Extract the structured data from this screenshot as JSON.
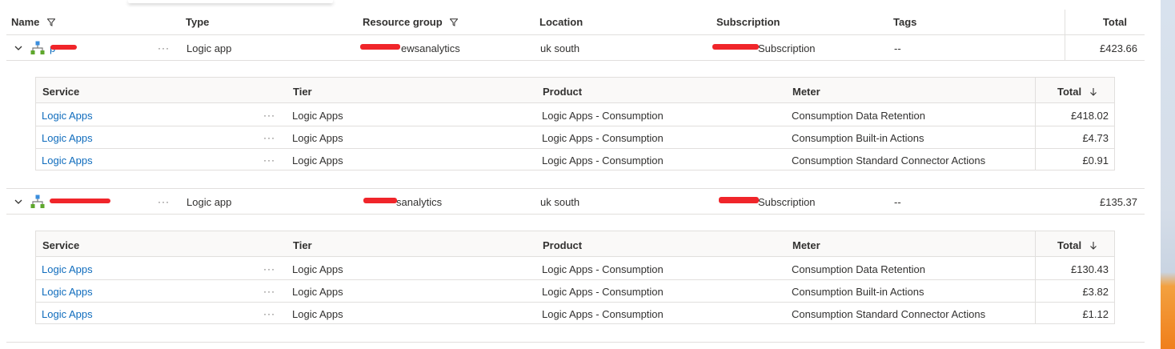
{
  "columns": {
    "name": "Name",
    "type": "Type",
    "resource_group": "Resource group",
    "location": "Location",
    "subscription": "Subscription",
    "tags": "Tags",
    "total": "Total"
  },
  "sub_columns": {
    "service": "Service",
    "tier": "Tier",
    "product": "Product",
    "meter": "Meter",
    "total": "Total"
  },
  "more_glyph": "···",
  "groups": [
    {
      "name": "p",
      "type": "Logic app",
      "resource_group": "ewsanalytics",
      "location": "uk south",
      "subscription": "Subscription",
      "tags": "--",
      "total": "£423.66",
      "rows": [
        {
          "service": "Logic Apps",
          "tier": "Logic Apps",
          "product": "Logic Apps - Consumption",
          "meter": "Consumption Data Retention",
          "total": "£418.02"
        },
        {
          "service": "Logic Apps",
          "tier": "Logic Apps",
          "product": "Logic Apps - Consumption",
          "meter": "Consumption Built-in Actions",
          "total": "£4.73"
        },
        {
          "service": "Logic Apps",
          "tier": "Logic Apps",
          "product": "Logic Apps - Consumption",
          "meter": "Consumption Standard Connector Actions",
          "total": "£0.91"
        }
      ]
    },
    {
      "name": "",
      "type": "Logic app",
      "resource_group": "sanalytics",
      "location": "uk south",
      "subscription": "Subscription",
      "tags": "--",
      "total": "£135.37",
      "rows": [
        {
          "service": "Logic Apps",
          "tier": "Logic Apps",
          "product": "Logic Apps - Consumption",
          "meter": "Consumption Data Retention",
          "total": "£130.43"
        },
        {
          "service": "Logic Apps",
          "tier": "Logic Apps",
          "product": "Logic Apps - Consumption",
          "meter": "Consumption Built-in Actions",
          "total": "£3.82"
        },
        {
          "service": "Logic Apps",
          "tier": "Logic Apps",
          "product": "Logic Apps - Consumption",
          "meter": "Consumption Standard Connector Actions",
          "total": "£1.12"
        }
      ]
    }
  ],
  "colors": {
    "link": "#0f6cbd",
    "redaction": "#f0252a",
    "border": "#e1dfdd"
  }
}
